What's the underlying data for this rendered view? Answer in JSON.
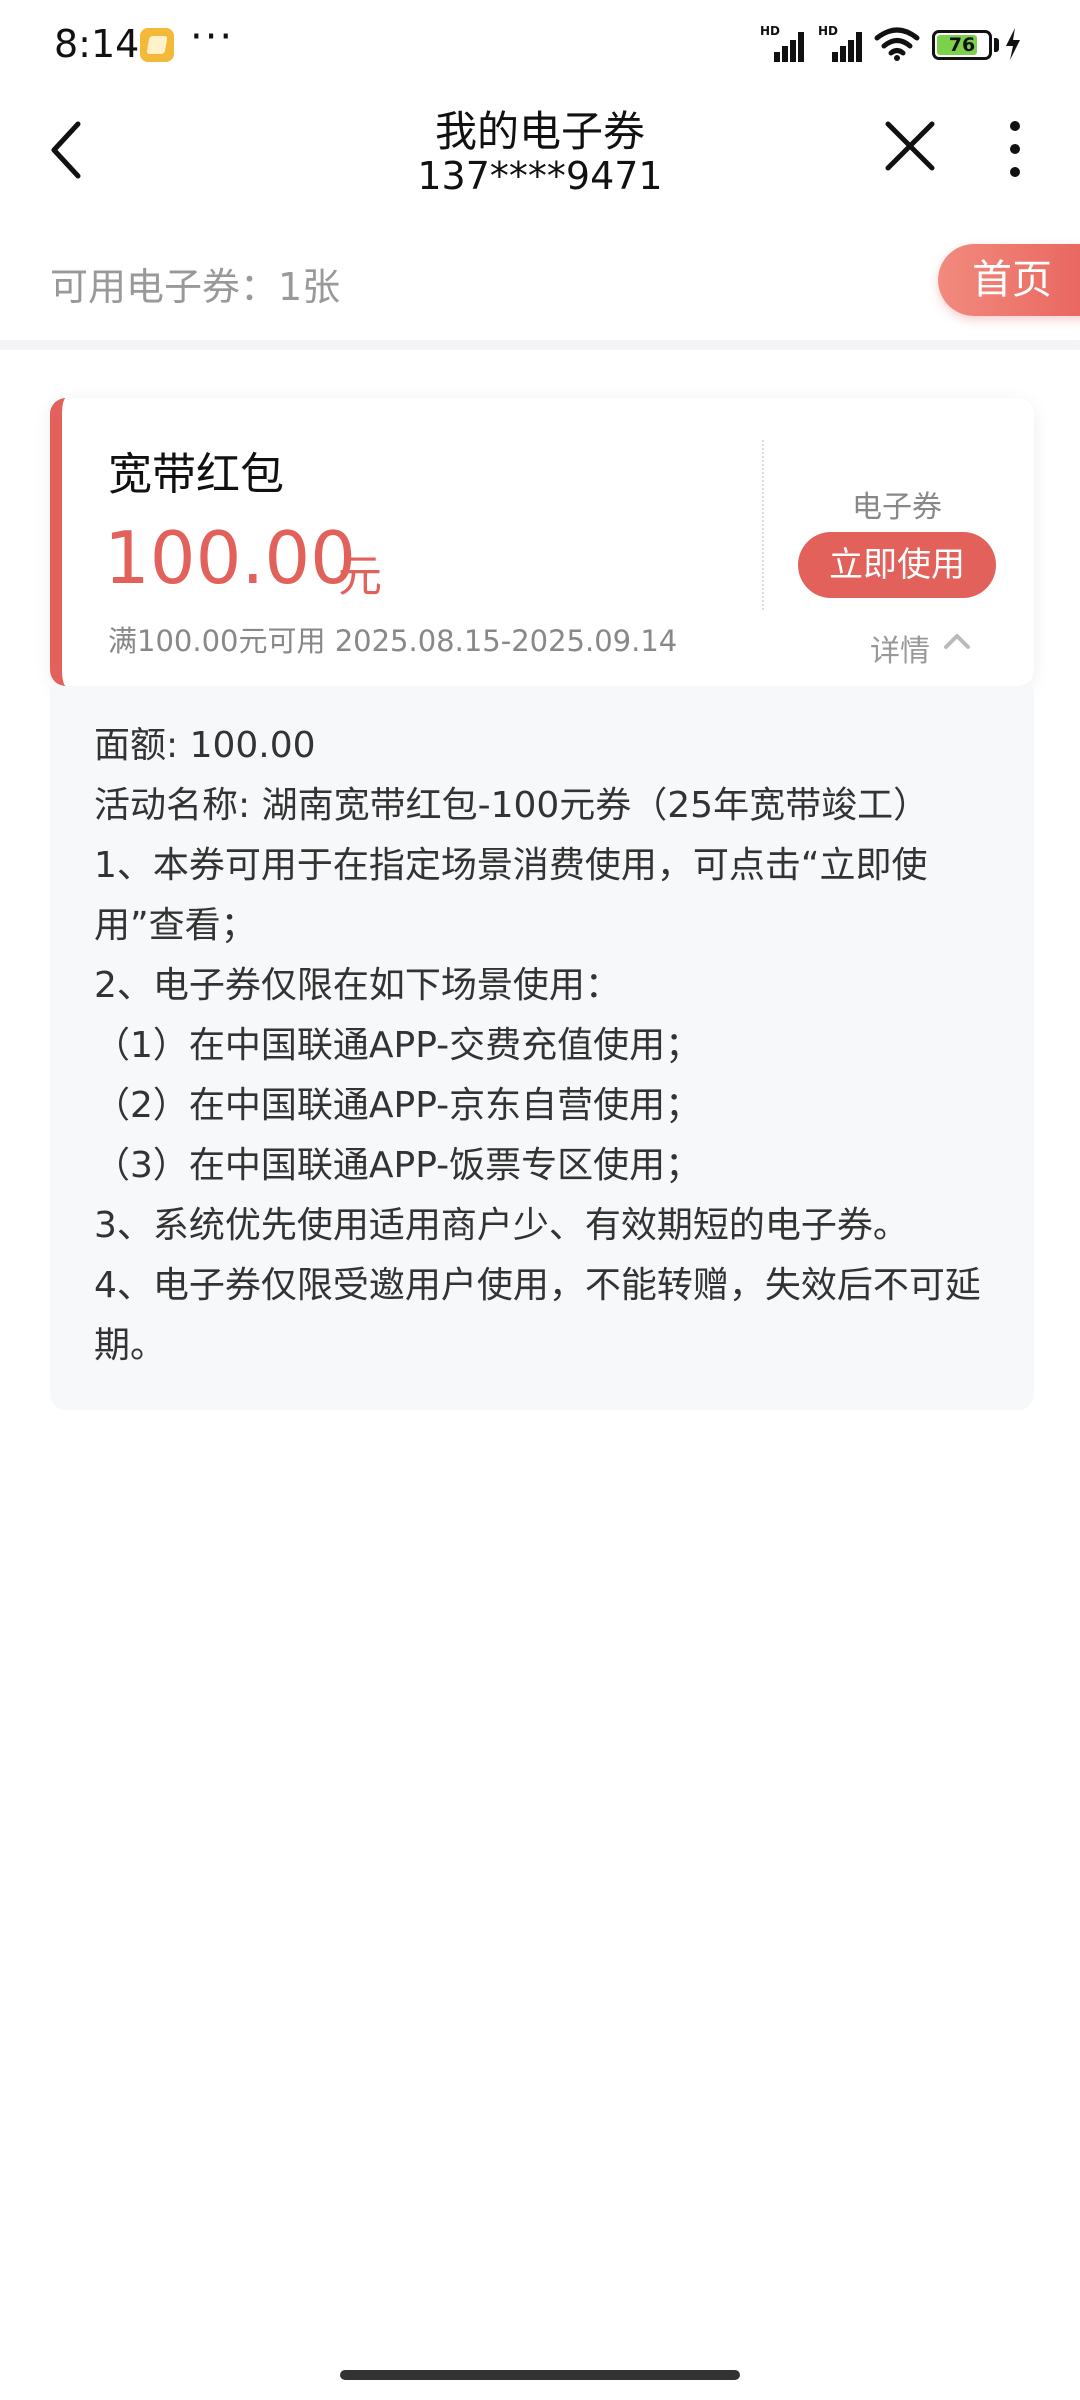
{
  "status_bar": {
    "time": "8:14",
    "more": "···",
    "signal_label": "HD",
    "battery": "76",
    "icons": [
      "app-notification-icon",
      "signal-icon",
      "wifi-icon",
      "battery-icon",
      "charging-icon"
    ]
  },
  "nav": {
    "title": "我的电子券",
    "subtitle": "137****9471",
    "icons": [
      "back-icon",
      "close-icon",
      "more-icon"
    ]
  },
  "summary": {
    "text": "可用电子券：1张",
    "home_label": "首页"
  },
  "coupon": {
    "name": "宽带红包",
    "amount": "100.00",
    "unit": "元",
    "condition": "满100.00元可用 2025.08.15-2025.09.14",
    "type": "电子券",
    "use_label": "立即使用",
    "details_label": "详情"
  },
  "details": {
    "lines": [
      "面额: 100.00",
      "活动名称: 湖南宽带红包-100元券（25年宽带竣工）",
      "1、本券可用于在指定场景消费使用，可点击“立即使用”查看；",
      "2、电子券仅限在如下场景使用：",
      "（1）在中国联通APP-交费充值使用；",
      "（2）在中国联通APP-京东自营使用；",
      "（3）在中国联通APP-饭票专区使用；",
      "3、系统优先使用适用商户少、有效期短的电子券。",
      "4、电子券仅限受邀用户使用，不能转赠，失效后不可延期。"
    ]
  },
  "colors": {
    "accent": "#e2615a",
    "muted": "#999999",
    "panel_bg": "#f7f8fa"
  }
}
